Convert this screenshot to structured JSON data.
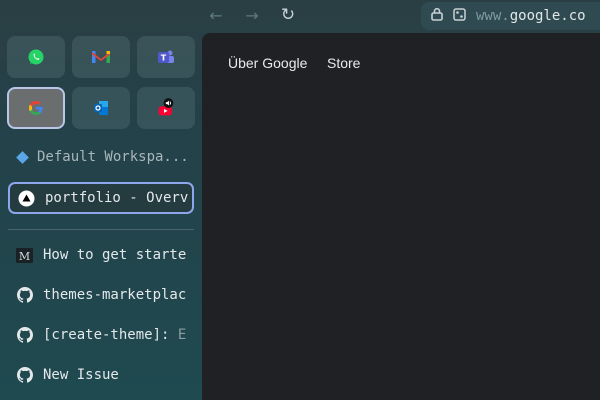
{
  "nav": {
    "back_icon": "arrow-left-icon",
    "forward_icon": "arrow-right-icon",
    "reload_icon": "reload-icon"
  },
  "urlbar": {
    "prefix": "www.",
    "domain": "google.co"
  },
  "essentials": [
    {
      "name": "whatsapp",
      "icon": "whatsapp-icon"
    },
    {
      "name": "gmail",
      "icon": "gmail-icon"
    },
    {
      "name": "teams",
      "icon": "teams-icon"
    },
    {
      "name": "google",
      "icon": "google-icon"
    },
    {
      "name": "outlook",
      "icon": "outlook-icon"
    },
    {
      "name": "youtube",
      "icon": "youtube-icon"
    }
  ],
  "workspace": {
    "label": "Default Workspa..."
  },
  "tabs": [
    {
      "title": "portfolio - Overv",
      "icon": "vercel-icon",
      "selected": true
    },
    {
      "title": "How to get starte",
      "icon": "medium-icon"
    },
    {
      "title": "themes-marketplac",
      "icon": "github-icon"
    },
    {
      "title_main": "[create-theme]: ",
      "title_dim": "E",
      "icon": "github-icon"
    },
    {
      "title": "New Issue",
      "icon": "github-icon"
    }
  ],
  "page": {
    "links": [
      "Über Google",
      "Store"
    ]
  },
  "colors": {
    "accent": "#8da6ec",
    "content_bg": "#202124"
  }
}
